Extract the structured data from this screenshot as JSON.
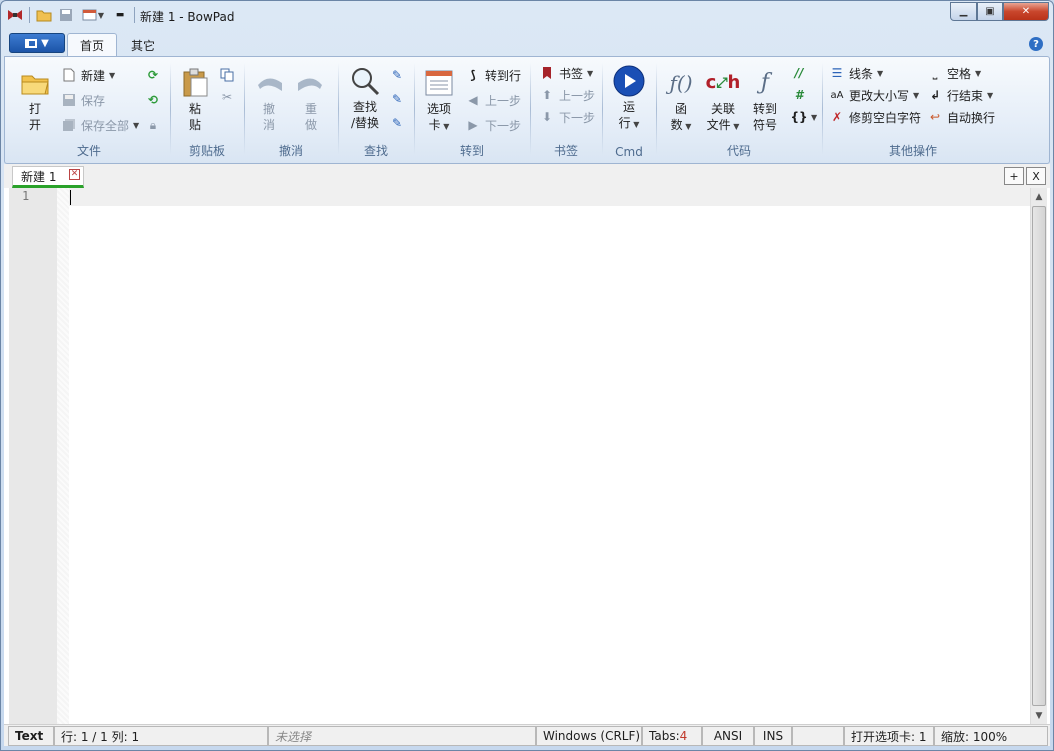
{
  "window": {
    "title": "新建 1 - BowPad"
  },
  "ribbon_tabs": {
    "home": "首页",
    "other": "其它"
  },
  "file_group": {
    "label": "文件",
    "open": "打",
    "open2": "开",
    "new": "新建",
    "save": "保存",
    "save_all": "保存全部"
  },
  "clipboard_group": {
    "label": "剪贴板",
    "paste": "粘",
    "paste2": "贴"
  },
  "undo_group": {
    "label": "撤消",
    "undo": "撤",
    "undo2": "消",
    "redo": "重",
    "redo2": "做"
  },
  "find_group": {
    "label": "查找",
    "find_replace": "查找",
    "find_replace2": "/替换"
  },
  "goto_group": {
    "label": "转到",
    "tabs": "选项",
    "tabs2": "卡",
    "goto_line": "转到行",
    "prev": "上一步",
    "next": "下一步"
  },
  "bookmark_group": {
    "label": "书签",
    "bookmarks": "书签",
    "prev": "上一步",
    "next": "下一步"
  },
  "cmd_group": {
    "label": "Cmd",
    "run": "运",
    "run2": "行"
  },
  "code_group": {
    "label": "代码",
    "func": "函",
    "func2": "数",
    "related": "关联",
    "related2": "文件",
    "goto_symbol": "转到",
    "goto_symbol2": "符号"
  },
  "other_group": {
    "label": "其他操作",
    "lines": "线条",
    "change_case": "更改大小写",
    "trim": "修剪空白字符",
    "spaces": "空格",
    "line_end": "行结束",
    "auto_wrap": "自动换行"
  },
  "doc_tab": {
    "name": "新建 1"
  },
  "editor": {
    "line1": "1"
  },
  "statusbar": {
    "lexer": "Text",
    "position": "行: 1 / 1    列: 1",
    "selection": "未选择",
    "eol": "Windows (CRLF)",
    "tabs_label": "Tabs: ",
    "tabs_value": "4",
    "encoding": "ANSI",
    "mode": "INS",
    "open_tabs": "打开选项卡: 1",
    "zoom": "缩放: 100%"
  },
  "colors": {
    "accent": "#1c55a8",
    "active_tab_underline": "#2aa22a",
    "tabs_value": "#c0392b"
  }
}
